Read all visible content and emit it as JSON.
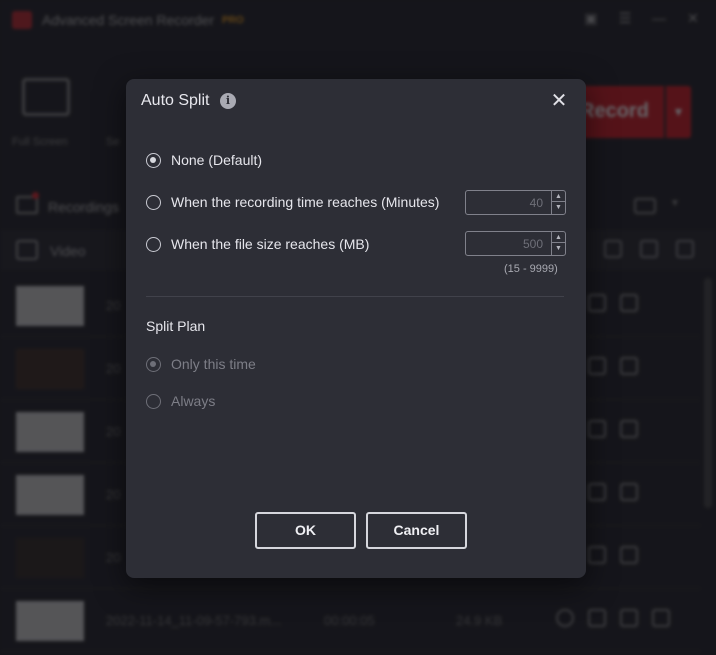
{
  "app": {
    "title": "Advanced Screen Recorder",
    "badge": "PRO",
    "mode_full_screen": "Full Screen",
    "mode_second": "Se",
    "record_label": "Record",
    "recordings_label": "Recordings",
    "video_tab_label": "Video",
    "last_row": {
      "name": "2022-11-14_11-09-57-793.m...",
      "duration": "00:00:05",
      "size": "24.9 KB"
    },
    "row_prefix": "20"
  },
  "dialog": {
    "title": "Auto Split",
    "options": [
      {
        "label": "None (Default)",
        "checked": true
      },
      {
        "label": "When the recording time reaches (Minutes)",
        "checked": false,
        "value": "40"
      },
      {
        "label": "When the file size reaches (MB)",
        "checked": false,
        "value": "500"
      }
    ],
    "range_hint": "(15 - 9999)",
    "split_plan": {
      "title": "Split Plan",
      "options": [
        {
          "label": "Only this time",
          "checked": true,
          "disabled": true
        },
        {
          "label": "Always",
          "checked": false,
          "disabled": true
        }
      ]
    },
    "ok_label": "OK",
    "cancel_label": "Cancel"
  },
  "icons": {
    "info": "info-icon",
    "close": "close-icon",
    "spin_up": "chevron-up-icon",
    "spin_down": "chevron-down-icon"
  }
}
